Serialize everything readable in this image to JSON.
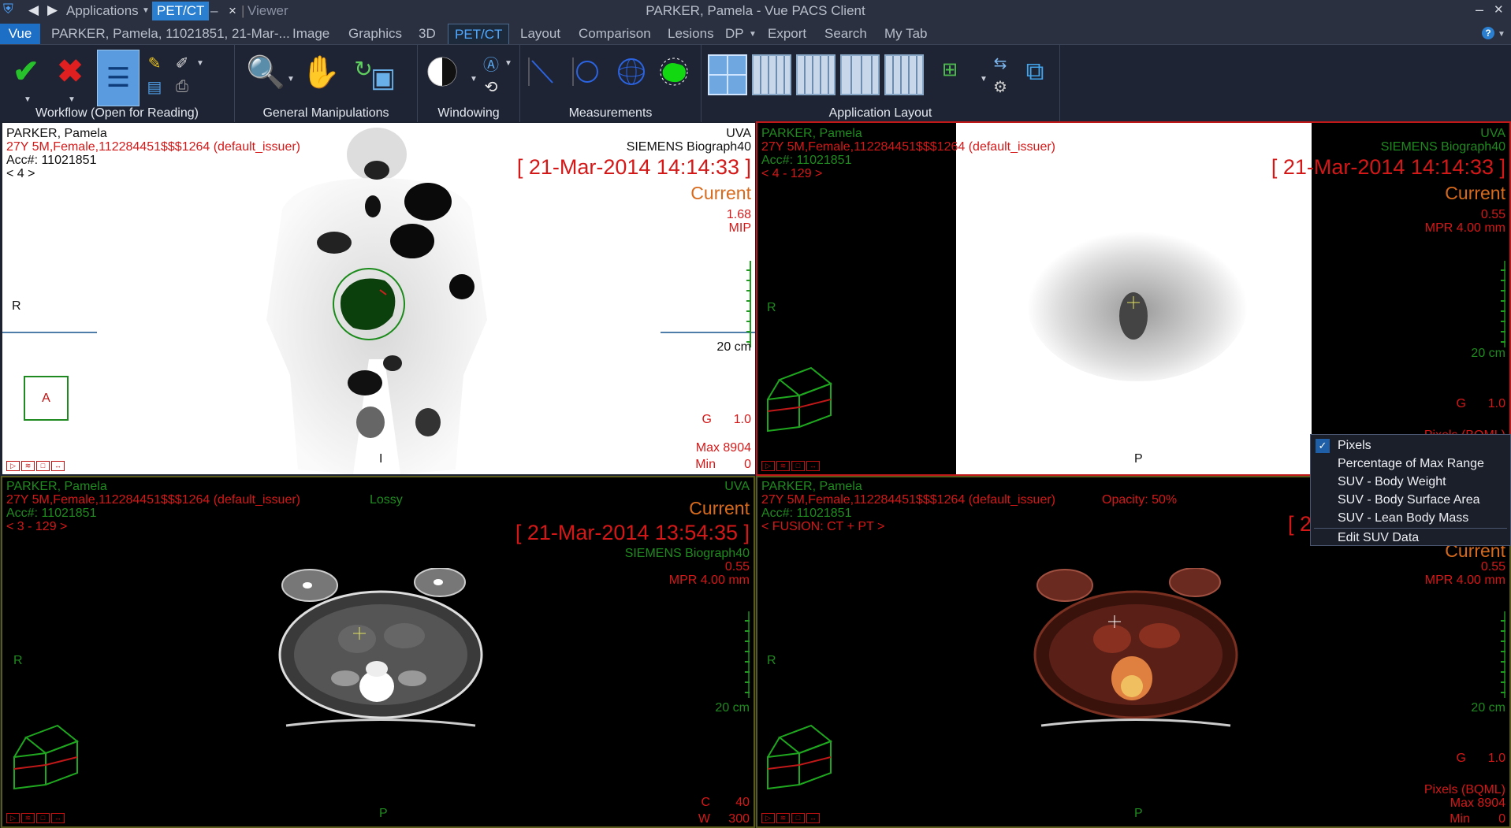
{
  "titlebar": {
    "applications": "Applications",
    "pet_ct": "PET/CT",
    "dash": "–",
    "close_x": "×",
    "viewer": "Viewer",
    "window_title": "PARKER, Pamela - Vue PACS Client",
    "minimize": "–",
    "maximize": "□",
    "close": "✕"
  },
  "menubar": {
    "tabs": [
      {
        "label": "Vue"
      },
      {
        "label": "PARKER, Pamela, 11021851, 21-Mar-..."
      },
      {
        "label": "Image"
      },
      {
        "label": "Graphics"
      },
      {
        "label": "3D"
      },
      {
        "label": "PET/CT"
      },
      {
        "label": "Layout"
      },
      {
        "label": "Comparison"
      },
      {
        "label": "Lesions"
      },
      {
        "label": "DP"
      },
      {
        "label": "Export"
      },
      {
        "label": "Search"
      },
      {
        "label": "My Tab"
      }
    ],
    "help": "?"
  },
  "ribbon": {
    "groups": [
      {
        "label": "Workflow (Open for Reading)"
      },
      {
        "label": "General Manipulations"
      },
      {
        "label": "Windowing"
      },
      {
        "label": "Measurements"
      },
      {
        "label": "Application Layout"
      }
    ]
  },
  "viewports": {
    "top_left": {
      "patient": "PARKER, Pamela",
      "info": "27Y 5M,Female,112284451$$$1264 (default_issuer)",
      "acc": "Acc#: 11021851",
      "series": "< 4 >",
      "institution": "UVA",
      "scanner": "SIEMENS Biograph40",
      "date": "[ 21-Mar-2014 14:14:33 ]",
      "current": "Current",
      "zoom": "1.68",
      "mode": "MIP",
      "orient_left": "R",
      "scale_label": "20 cm",
      "orient_box": "A",
      "gamma_label": "G",
      "gamma_value": "1.0",
      "max_label": "Max 8904",
      "min_label": "Min",
      "min_value": "0",
      "orient_bottom": "I"
    },
    "top_right": {
      "patient": "PARKER, Pamela",
      "info": "27Y 5M,Female,112284451$$$1264 (default_issuer)",
      "acc": "Acc#: 11021851",
      "series": "< 4 - 129 >",
      "institution": "UVA",
      "scanner": "SIEMENS Biograph40",
      "date": "[ 21-Mar-2014 14:14:33 ]",
      "current": "Current",
      "zoom": "0.55",
      "mpr": "MPR 4.00 mm",
      "orient_left": "R",
      "scale_label": "20 cm",
      "gamma_label": "G",
      "gamma_value": "1.0",
      "pixels_partial": "Pixels (BQML)",
      "orient_bottom": "P"
    },
    "bottom_left": {
      "patient": "PARKER, Pamela",
      "info": "27Y 5M,Female,112284451$$$1264 (default_issuer)",
      "lossy": "Lossy",
      "acc": "Acc#: 11021851",
      "series": "< 3 - 129 >",
      "institution": "UVA",
      "current": "Current",
      "date": "[ 21-Mar-2014 13:54:35 ]",
      "scanner": "SIEMENS Biograph40",
      "zoom": "0.55",
      "mpr": "MPR 4.00 mm",
      "orient_left": "R",
      "scale_label": "20 cm",
      "c_label": "C",
      "c_value": "40",
      "w_label": "W",
      "w_value": "300",
      "orient_bottom": "P"
    },
    "bottom_right": {
      "patient": "PARKER, Pamela",
      "info": "27Y 5M,Female,112284451$$$1264 (default_issuer)",
      "opacity": "Opacity: 50%",
      "acc": "Acc#: 11021851",
      "series": "< FUSION: CT + PT >",
      "date_partial": "[ 2",
      "current": "Current",
      "zoom": "0.55",
      "mpr": "MPR 4.00 mm",
      "orient_left": "R",
      "scale_label": "20 cm",
      "gamma_label": "G",
      "gamma_value": "1.0",
      "pixels": "Pixels (BQML)",
      "max_label": "Max 8904",
      "min_label": "Min",
      "min_value": "0",
      "orient_bottom": "P"
    }
  },
  "context_menu": {
    "items": [
      {
        "label": "Pixels",
        "checked": true
      },
      {
        "label": "Percentage of Max Range"
      },
      {
        "label": "SUV - Body Weight"
      },
      {
        "label": "SUV - Body Surface Area"
      },
      {
        "label": "SUV - Lean Body Mass"
      },
      {
        "label": "Edit SUV Data"
      }
    ]
  }
}
